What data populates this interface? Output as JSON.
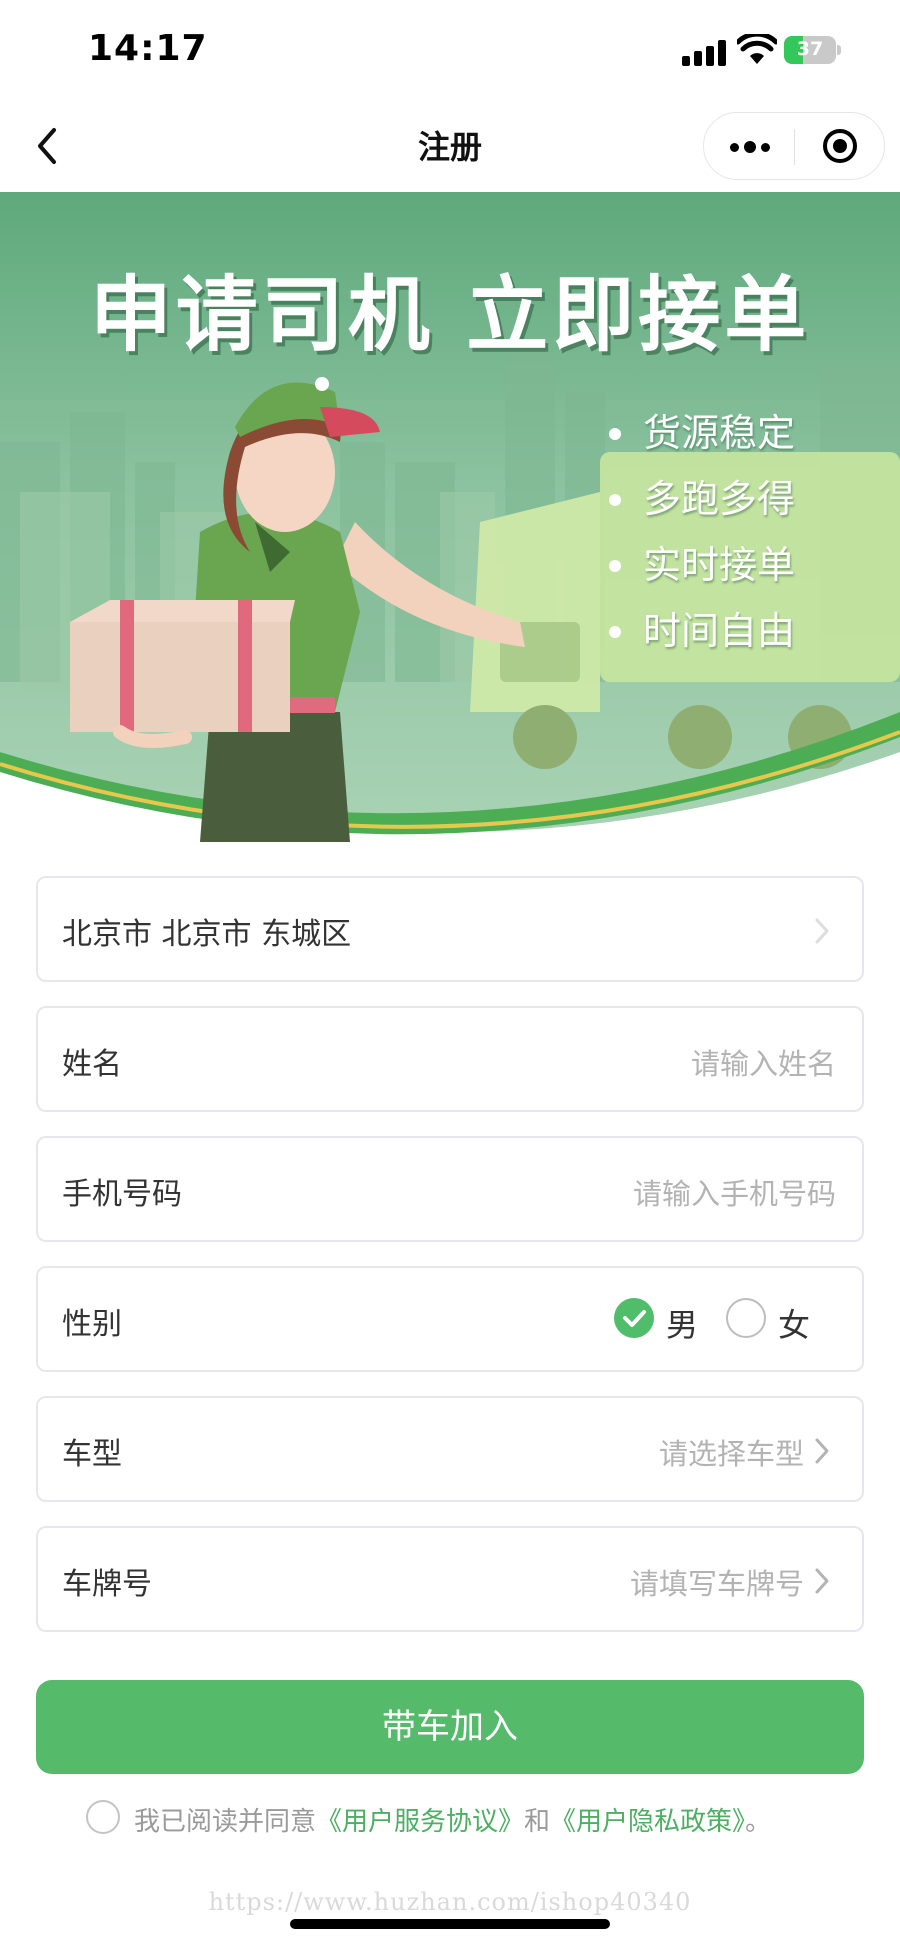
{
  "status_bar": {
    "time": "14:17",
    "battery_percent": "37",
    "battery_level": 0.37
  },
  "nav": {
    "title": "注册",
    "back_icon": "chevron-left-icon",
    "more_icon": "more-dots-icon",
    "close_icon": "target-close-icon"
  },
  "banner": {
    "title": "申请司机 立即接单",
    "bullets": [
      "货源稳定",
      "多跑多得",
      "实时接单",
      "时间自由"
    ]
  },
  "form": {
    "region": {
      "value": "北京市 北京市 东城区"
    },
    "name": {
      "label": "姓名",
      "placeholder": "请输入姓名"
    },
    "phone": {
      "label": "手机号码",
      "placeholder": "请输入手机号码"
    },
    "gender": {
      "label": "性别",
      "options": [
        "男",
        "女"
      ],
      "selected": "男"
    },
    "vehicle_type": {
      "label": "车型",
      "placeholder": "请选择车型"
    },
    "plate": {
      "label": "车牌号",
      "placeholder": "请填写车牌号"
    }
  },
  "submit": {
    "label": "带车加入"
  },
  "agreement": {
    "prefix": "我已阅读并同意",
    "terms": "《用户服务协议》",
    "conjunction": "和",
    "privacy": "《用户隐私政策》",
    "suffix": "。",
    "checked": false
  },
  "watermark": "https://www.huzhan.com/ishop40340",
  "colors": {
    "accent": "#55bb6b",
    "link": "#4caf62",
    "placeholder": "#b3b3b3",
    "border": "#e6e6ee"
  }
}
